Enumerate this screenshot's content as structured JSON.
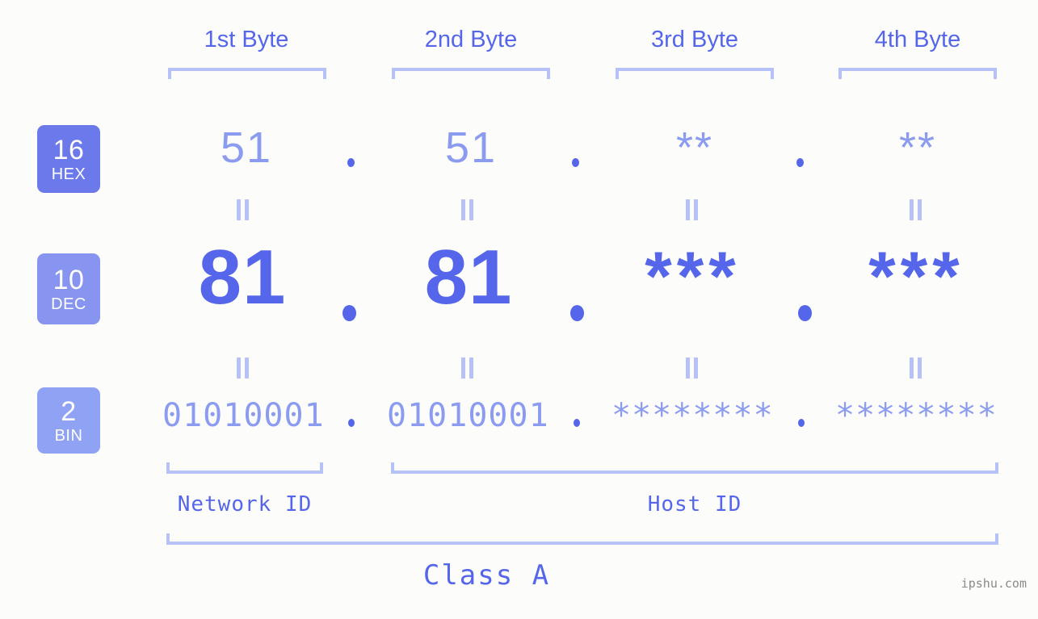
{
  "background_color": "#fcfdfa",
  "accent_color": "#5566ea",
  "accent_light_color": "#8b9bf0",
  "bracket_color": "#b6c1f7",
  "byte_headers": [
    {
      "label": "1st Byte"
    },
    {
      "label": "2nd Byte"
    },
    {
      "label": "3rd Byte"
    },
    {
      "label": "4th Byte"
    }
  ],
  "rows": [
    {
      "radix": "16",
      "radix_name": "HEX",
      "badge_color": "#6b79ea",
      "values": [
        "51",
        "51",
        "**",
        "**"
      ],
      "separator": "."
    },
    {
      "radix": "10",
      "radix_name": "DEC",
      "badge_color": "#8795f0",
      "values": [
        "81",
        "81",
        "***",
        "***"
      ],
      "separator": "."
    },
    {
      "radix": "2",
      "radix_name": "BIN",
      "badge_color": "#8fa2f4",
      "values": [
        "01010001",
        "01010001",
        "********",
        "********"
      ],
      "separator": "."
    }
  ],
  "equals_glyph": "||",
  "id_sections": [
    {
      "label": "Network ID"
    },
    {
      "label": "Host ID"
    }
  ],
  "class_label": "Class A",
  "watermark": "ipshu.com"
}
